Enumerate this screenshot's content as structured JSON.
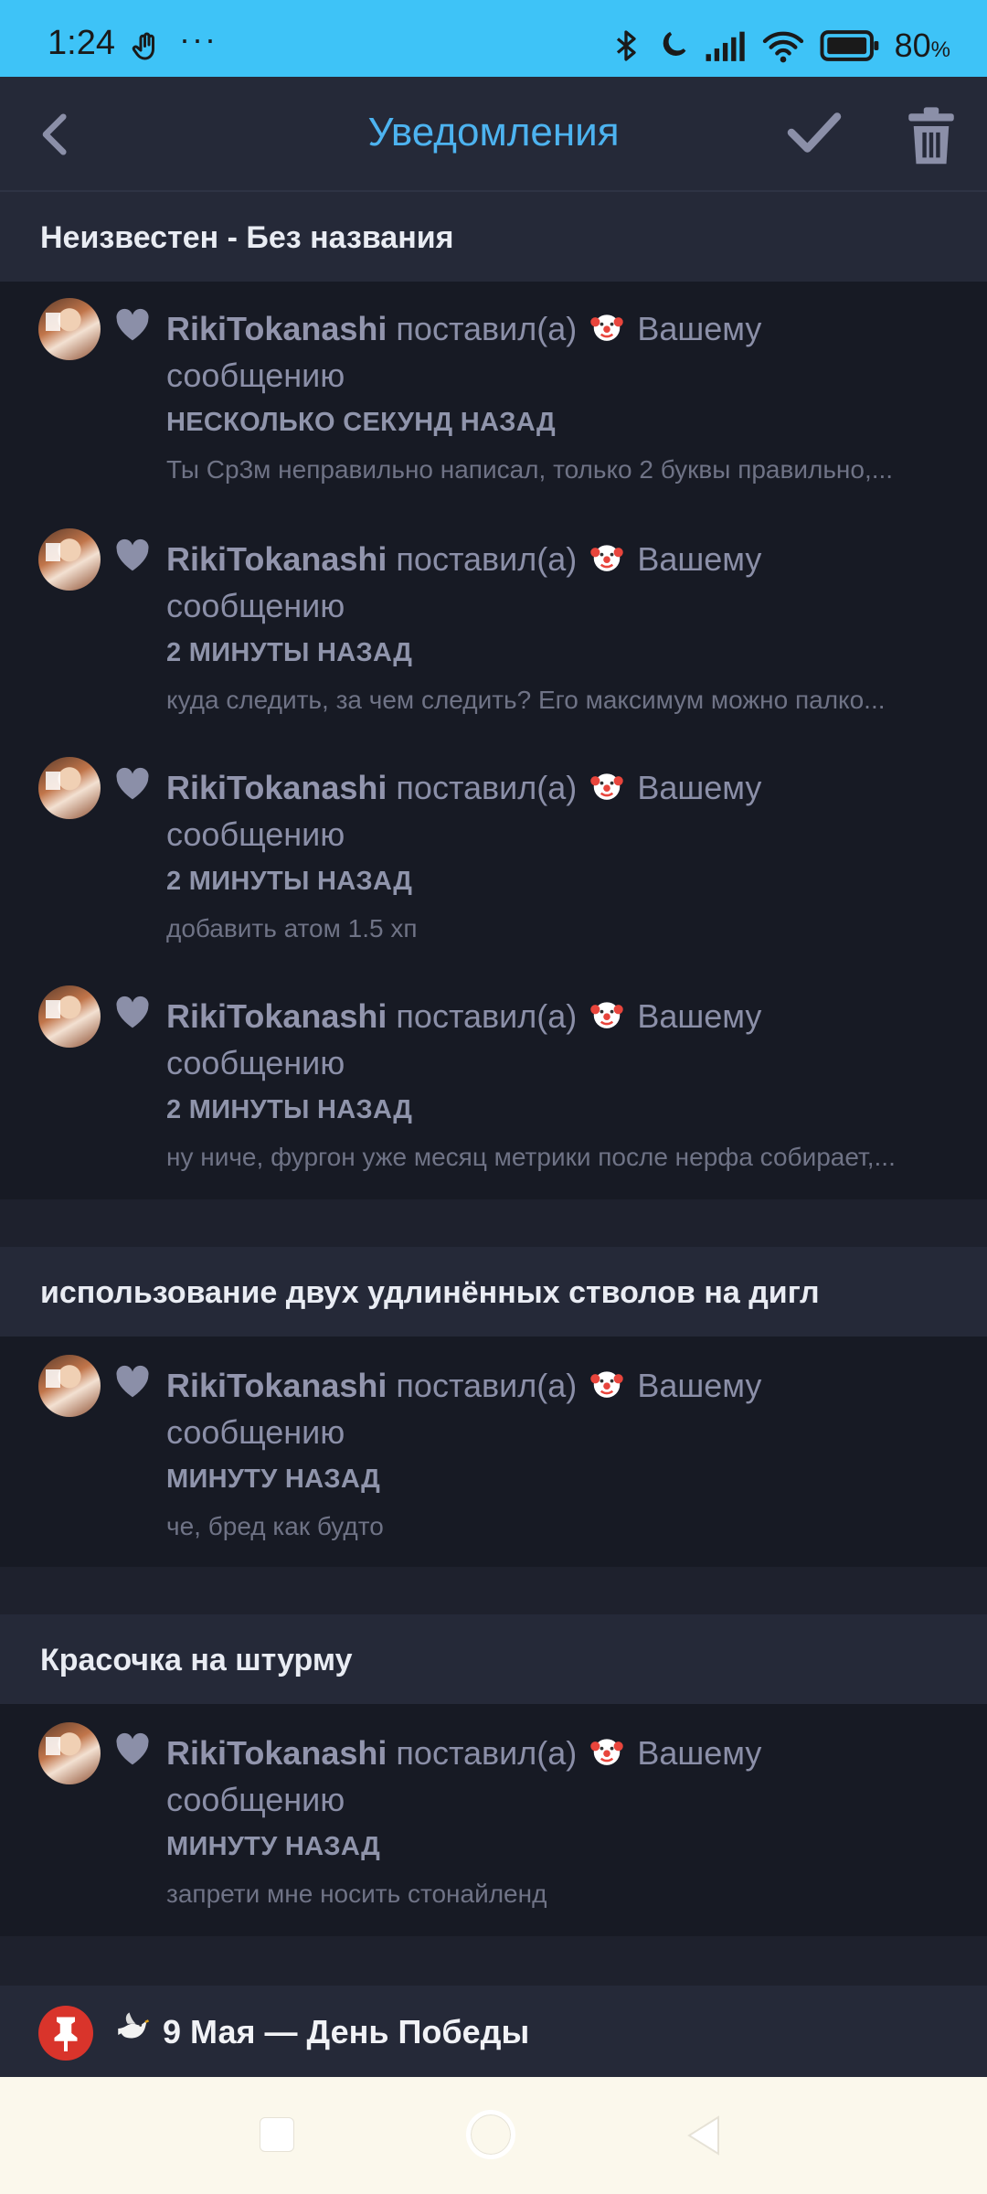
{
  "status_bar": {
    "time": "1:24",
    "dots": "···",
    "battery_pct": "80",
    "battery_unit": "%"
  },
  "app_bar": {
    "title": "Уведомления"
  },
  "sections": [
    {
      "title": "Неизвестен - Без названия",
      "items": [
        {
          "user": "RikiTokanashi",
          "action": "поставил(а)",
          "target": "Вашему",
          "target2": "сообщению",
          "time": "НЕСКОЛЬКО СЕКУНД НАЗАД",
          "snippet": "Ты Ср3м неправильно написал, только 2 буквы правильно,..."
        },
        {
          "user": "RikiTokanashi",
          "action": "поставил(а)",
          "target": "Вашему",
          "target2": "сообщению",
          "time": "2 МИНУТЫ НАЗАД",
          "snippet": "куда следить, за чем следить? Его максимум можно палко..."
        },
        {
          "user": "RikiTokanashi",
          "action": "поставил(а)",
          "target": "Вашему",
          "target2": "сообщению",
          "time": "2 МИНУТЫ НАЗАД",
          "snippet": "добавить атом 1.5 хп"
        },
        {
          "user": "RikiTokanashi",
          "action": "поставил(а)",
          "target": "Вашему",
          "target2": "сообщению",
          "time": "2 МИНУТЫ НАЗАД",
          "snippet": "ну ниче, фургон уже месяц метрики после нерфа собирает,..."
        }
      ]
    },
    {
      "title": "использование двух удлинённых стволов на дигл",
      "items": [
        {
          "user": "RikiTokanashi",
          "action": "поставил(а)",
          "target": "Вашему",
          "target2": "сообщению",
          "time": "МИНУТУ НАЗАД",
          "snippet": "че, бред как будто"
        }
      ]
    },
    {
      "title": "Красочка на штурму",
      "items": [
        {
          "user": "RikiTokanashi",
          "action": "поставил(а)",
          "target": "Вашему",
          "target2": "сообщению",
          "time": "МИНУТУ НАЗАД",
          "snippet": "запрети мне носить стонайленд"
        }
      ]
    }
  ],
  "pinned": {
    "label": "9 Мая — День Победы"
  },
  "colors": {
    "status_bar": "#3ec3f7",
    "accent": "#4db3f0",
    "pin": "#d9342b"
  }
}
